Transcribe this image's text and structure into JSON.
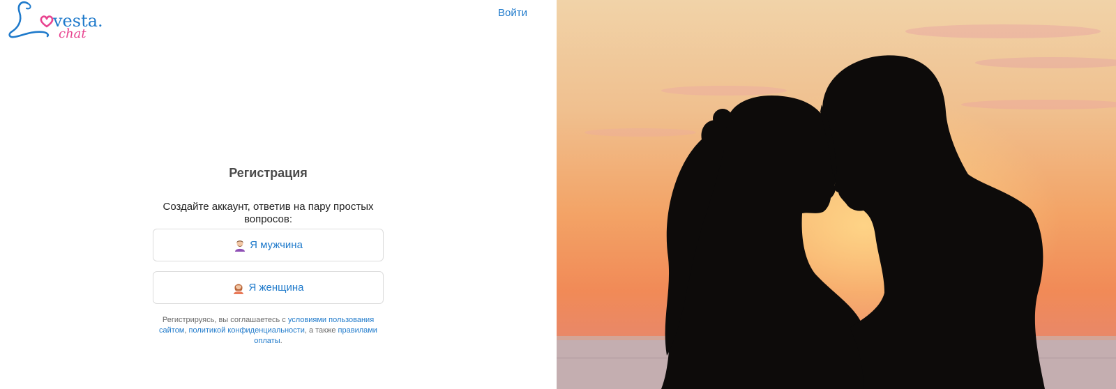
{
  "brand": {
    "name": "Lovesta",
    "dot": ".",
    "chat": "chat",
    "logo_letter": "L",
    "heart_color": "#e8438f",
    "script_color": "#1f7acb"
  },
  "header": {
    "login_label": "Войти"
  },
  "registration": {
    "title": "Регистрация",
    "subtitle": "Создайте аккаунт, ответив на пару простых вопросов:",
    "options": [
      {
        "label": "Я мужчина",
        "icon": "man-emoji-icon"
      },
      {
        "label": "Я женщина",
        "icon": "woman-emoji-icon"
      }
    ],
    "legal": {
      "prefix": "Регистрируясь, вы соглашаетесь с ",
      "terms": "условиями пользования сайтом",
      "comma": ", ",
      "privacy": "политикой конфиденциальности",
      "middle": ", а также ",
      "payment": "правилами оплаты",
      "suffix": "."
    }
  },
  "hero": {
    "image": "sunset-couple-silhouette",
    "link_color": "#1f7acb"
  }
}
